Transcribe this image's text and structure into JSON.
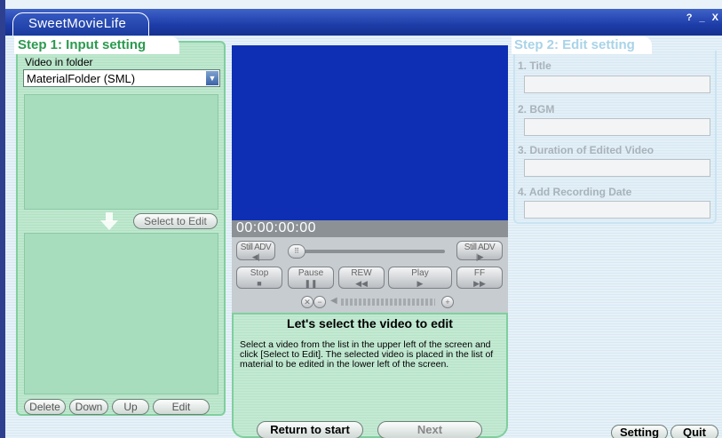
{
  "window": {
    "title": "SweetMovieLife",
    "controls": [
      "?",
      "_",
      "X"
    ]
  },
  "step1": {
    "title": "Step 1: Input setting",
    "folder_label": "Video in folder",
    "folder_value": "MaterialFolder (SML)",
    "select_to_edit": "Select to Edit",
    "buttons": {
      "delete": "Delete",
      "down": "Down",
      "up": "Up",
      "edit": "Edit"
    }
  },
  "player": {
    "timecode": "00:00:00:00",
    "still_adv": "Still ADV",
    "stop": "Stop",
    "pause": "Pause",
    "rew": "REW",
    "play": "Play",
    "ff": "FF"
  },
  "guide": {
    "title": "Let's select the video to edit",
    "text": "Select a video from the list in the upper left of the screen and click [Select to Edit]. The selected video is placed in the list of material to be edited in the lower left of the screen.",
    "return_button": "Return to start",
    "next_button": "Next"
  },
  "step2": {
    "title": "Step 2: Edit setting",
    "fields": [
      {
        "label": "1. Title",
        "value": ""
      },
      {
        "label": "2. BGM",
        "value": ""
      },
      {
        "label": "3. Duration of Edited Video",
        "value": ""
      },
      {
        "label": "4. Add Recording Date",
        "value": ""
      }
    ]
  },
  "footer": {
    "setting": "Setting",
    "quit": "Quit"
  },
  "colors": {
    "titlebar": "#1d3ca8",
    "step1_accent": "#2a9a4e",
    "step1_panel": "#bfe8cf",
    "video_screen": "#0e2fb3",
    "step2_accent": "#a9d3e8"
  }
}
